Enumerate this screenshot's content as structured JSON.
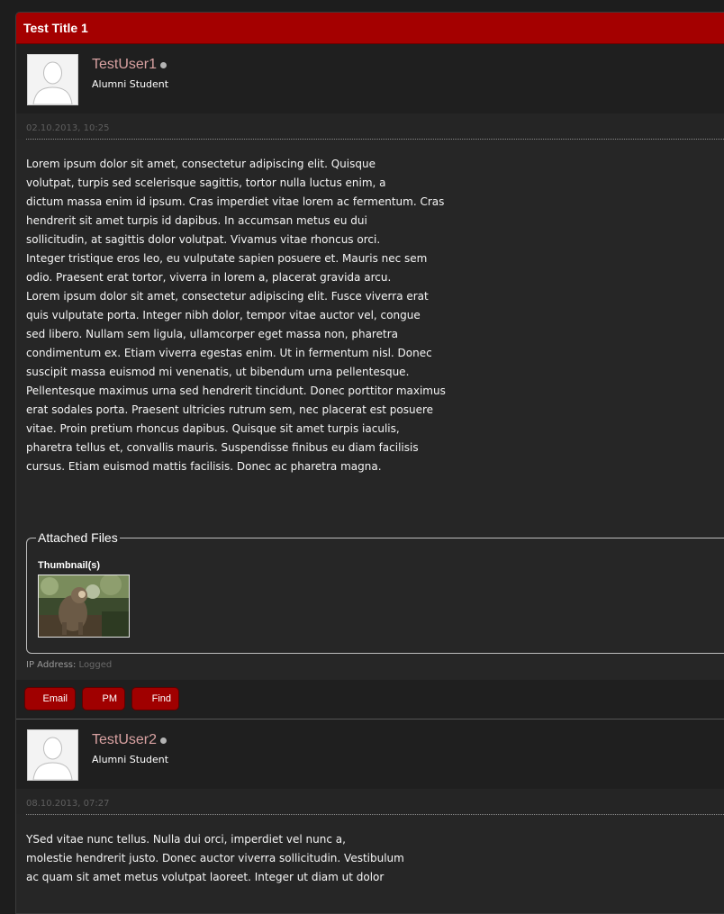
{
  "thread": {
    "title": "Test Title 1"
  },
  "posts": [
    {
      "username": "TestUser1",
      "user_title": "Alumni Student",
      "date": "02.10.2013, 10:25",
      "body": "Lorem ipsum dolor sit amet, consectetur adipiscing elit. Quisque\nvolutpat, turpis sed scelerisque sagittis, tortor nulla luctus enim, a\ndictum massa enim id ipsum. Cras imperdiet vitae lorem ac fermentum. Cras\nhendrerit sit amet turpis id dapibus. In accumsan metus eu dui\nsollicitudin, at sagittis dolor volutpat. Vivamus vitae rhoncus orci.\nInteger tristique eros leo, eu vulputate sapien posuere et. Mauris nec sem\nodio. Praesent erat tortor, viverra in lorem a, placerat gravida arcu.\nLorem ipsum dolor sit amet, consectetur adipiscing elit. Fusce viverra erat\nquis vulputate porta. Integer nibh dolor, tempor vitae auctor vel, congue\nsed libero. Nullam sem ligula, ullamcorper eget massa non, pharetra\ncondimentum ex. Etiam viverra egestas enim. Ut in fermentum nisl. Donec\nsuscipit massa euismod mi venenatis, ut bibendum urna pellentesque.\nPellentesque maximus urna sed hendrerit tincidunt. Donec porttitor maximus\nerat sodales porta. Praesent ultricies rutrum sem, nec placerat est posuere\nvitae. Proin pretium rhoncus dapibus. Quisque sit amet turpis iaculis,\npharetra tellus et, convallis mauris. Suspendisse finibus eu diam facilisis\ncursus. Etiam euismod mattis facilisis. Donec ac pharetra magna.",
      "attachments_label": "Attached Files",
      "thumbnails_label": "Thumbnail(s)",
      "ip_label": "IP Address:",
      "ip_value": "Logged",
      "buttons": [
        "Email",
        "PM",
        "Find"
      ]
    },
    {
      "username": "TestUser2",
      "user_title": "Alumni Student",
      "date": "08.10.2013, 07:27",
      "body": "YSed vitae nunc tellus. Nulla dui orci, imperdiet vel nunc a,\nmolestie hendrerit justo. Donec auctor viverra sollicitudin. Vestibulum\nac quam sit amet metus volutpat laoreet. Integer ut diam ut dolor"
    }
  ],
  "colors": {
    "header_red": "#a40000",
    "button_red": "#a00000",
    "username": "#d9a2a2"
  }
}
